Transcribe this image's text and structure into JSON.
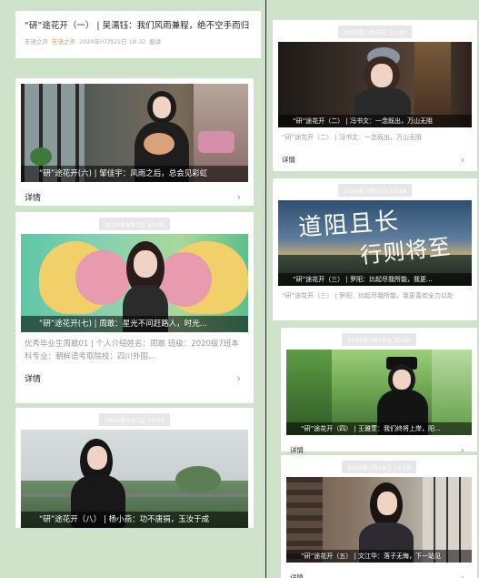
{
  "top_article": {
    "title": "“研”途花开（一） | 吴濡钰：我们风雨兼程，绝不空手而归",
    "source": "东语之声",
    "source2": "东语之声",
    "date": "2024年07月22日 18:32",
    "extra": "翻译"
  },
  "left_cards": [
    {
      "date": "",
      "caption": "“研”途花开(六) | 邹佳宇：风雨之后，总会见彩虹",
      "summary": "",
      "detail_label": "详情"
    },
    {
      "date": "2024年8月1日 10:00",
      "caption": "“研”途花开(七) | 周敢：星光不问赶路人，时光...",
      "summary": "优秀毕业生周敢01 | 个人介绍姓名：周敢 班级：2020级7班本科专业：朝鲜语考取院校：四川外国...",
      "detail_label": "详情"
    },
    {
      "date": "2024年8月2日 10:02",
      "caption": "“研”途花开（八） | 杨小燕：功不唐捐，玉汝于成",
      "summary": "",
      "detail_label": ""
    }
  ],
  "right_cards": [
    {
      "date": "2024年7月25日 22:42",
      "caption": "“研”途花开（二） | 冯书文：一念既出，万山无阻",
      "summary": "“研”途花开（二） | 冯书文：一念既出，万山无阻",
      "detail_label": "详情"
    },
    {
      "date": "2024年7月27日 23:28",
      "caption": "“研”途花开（三） | 罗阳：比起尽我所能，我更...",
      "summary": "“研”途花开（三） | 罗阳：比起尽我所能，我更喜欢全力以赴",
      "detail_label": "",
      "art_text_1": "道阻且长",
      "art_text_2": "行则将至"
    },
    {
      "date": "2024年7月28日 20:40",
      "caption": "“研”途花开（四） | 王雅萱：我们终将上岸，阳...",
      "summary": "",
      "detail_label": "详情"
    },
    {
      "date": "2024年7月29日 19:56",
      "caption": "“研”途花开（五） | 文江华：落子无悔，下一站见",
      "summary": "",
      "detail_label": "详情"
    }
  ],
  "chevron_icon": "chevron-right-icon",
  "colors": {
    "page_bg": "#cfe3cb",
    "caption_bg": "#000000",
    "date_chip_bg": "#e7e7e7"
  }
}
